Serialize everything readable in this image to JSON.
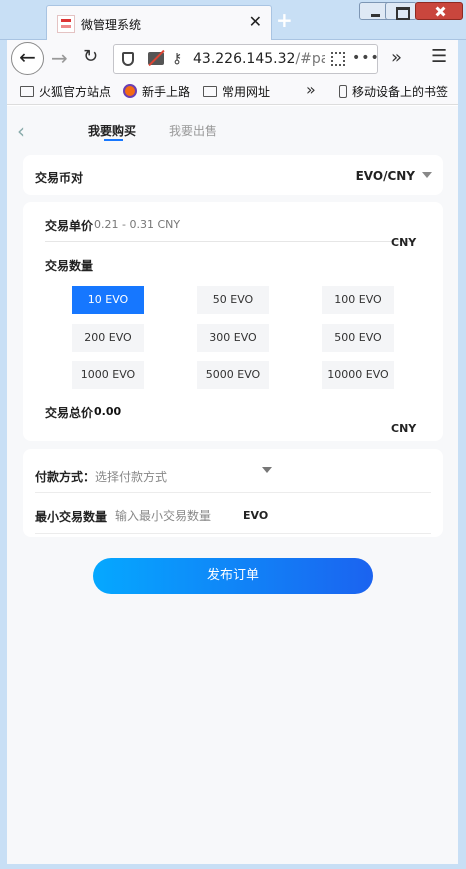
{
  "browser": {
    "tab_title": "微管理系统",
    "tab_close": "✕",
    "new_tab": "+",
    "url_host": "43.226.145.32",
    "url_path": "/#page",
    "url_more": "•••",
    "bookmarks": [
      {
        "label": "火狐官方站点",
        "icon": "folder-icon"
      },
      {
        "label": "新手上路",
        "icon": "firefox-icon"
      },
      {
        "label": "常用网址",
        "icon": "folder-icon"
      }
    ],
    "bookmarks_overflow": "»",
    "mobile_bookmarks": "移动设备上的书签"
  },
  "header": {
    "back": "‹",
    "tab_buy": "我要购买",
    "tab_sell": "我要出售"
  },
  "pair": {
    "label": "交易币对",
    "value": "EVO/CNY"
  },
  "trade": {
    "price_label": "交易单价",
    "price_range": "0.21 - 0.31 CNY",
    "price_unit": "CNY",
    "qty_label": "交易数量",
    "quantities": [
      "10 EVO",
      "50 EVO",
      "100 EVO",
      "200 EVO",
      "300 EVO",
      "500 EVO",
      "1000 EVO",
      "5000 EVO",
      "10000 EVO"
    ],
    "selected_quantity": "10 EVO",
    "total_label": "交易总价",
    "total_value": "0.00",
    "total_unit": "CNY"
  },
  "payment": {
    "label": "付款方式：",
    "placeholder": "选择付款方式",
    "min_label": "最小交易数量",
    "min_placeholder": "输入最小交易数量",
    "min_unit": "EVO"
  },
  "submit_label": "发布订单",
  "colors": {
    "accent": "#1677ff",
    "button_gradient_start": "#05a8ff",
    "button_gradient_end": "#1b63f0"
  }
}
